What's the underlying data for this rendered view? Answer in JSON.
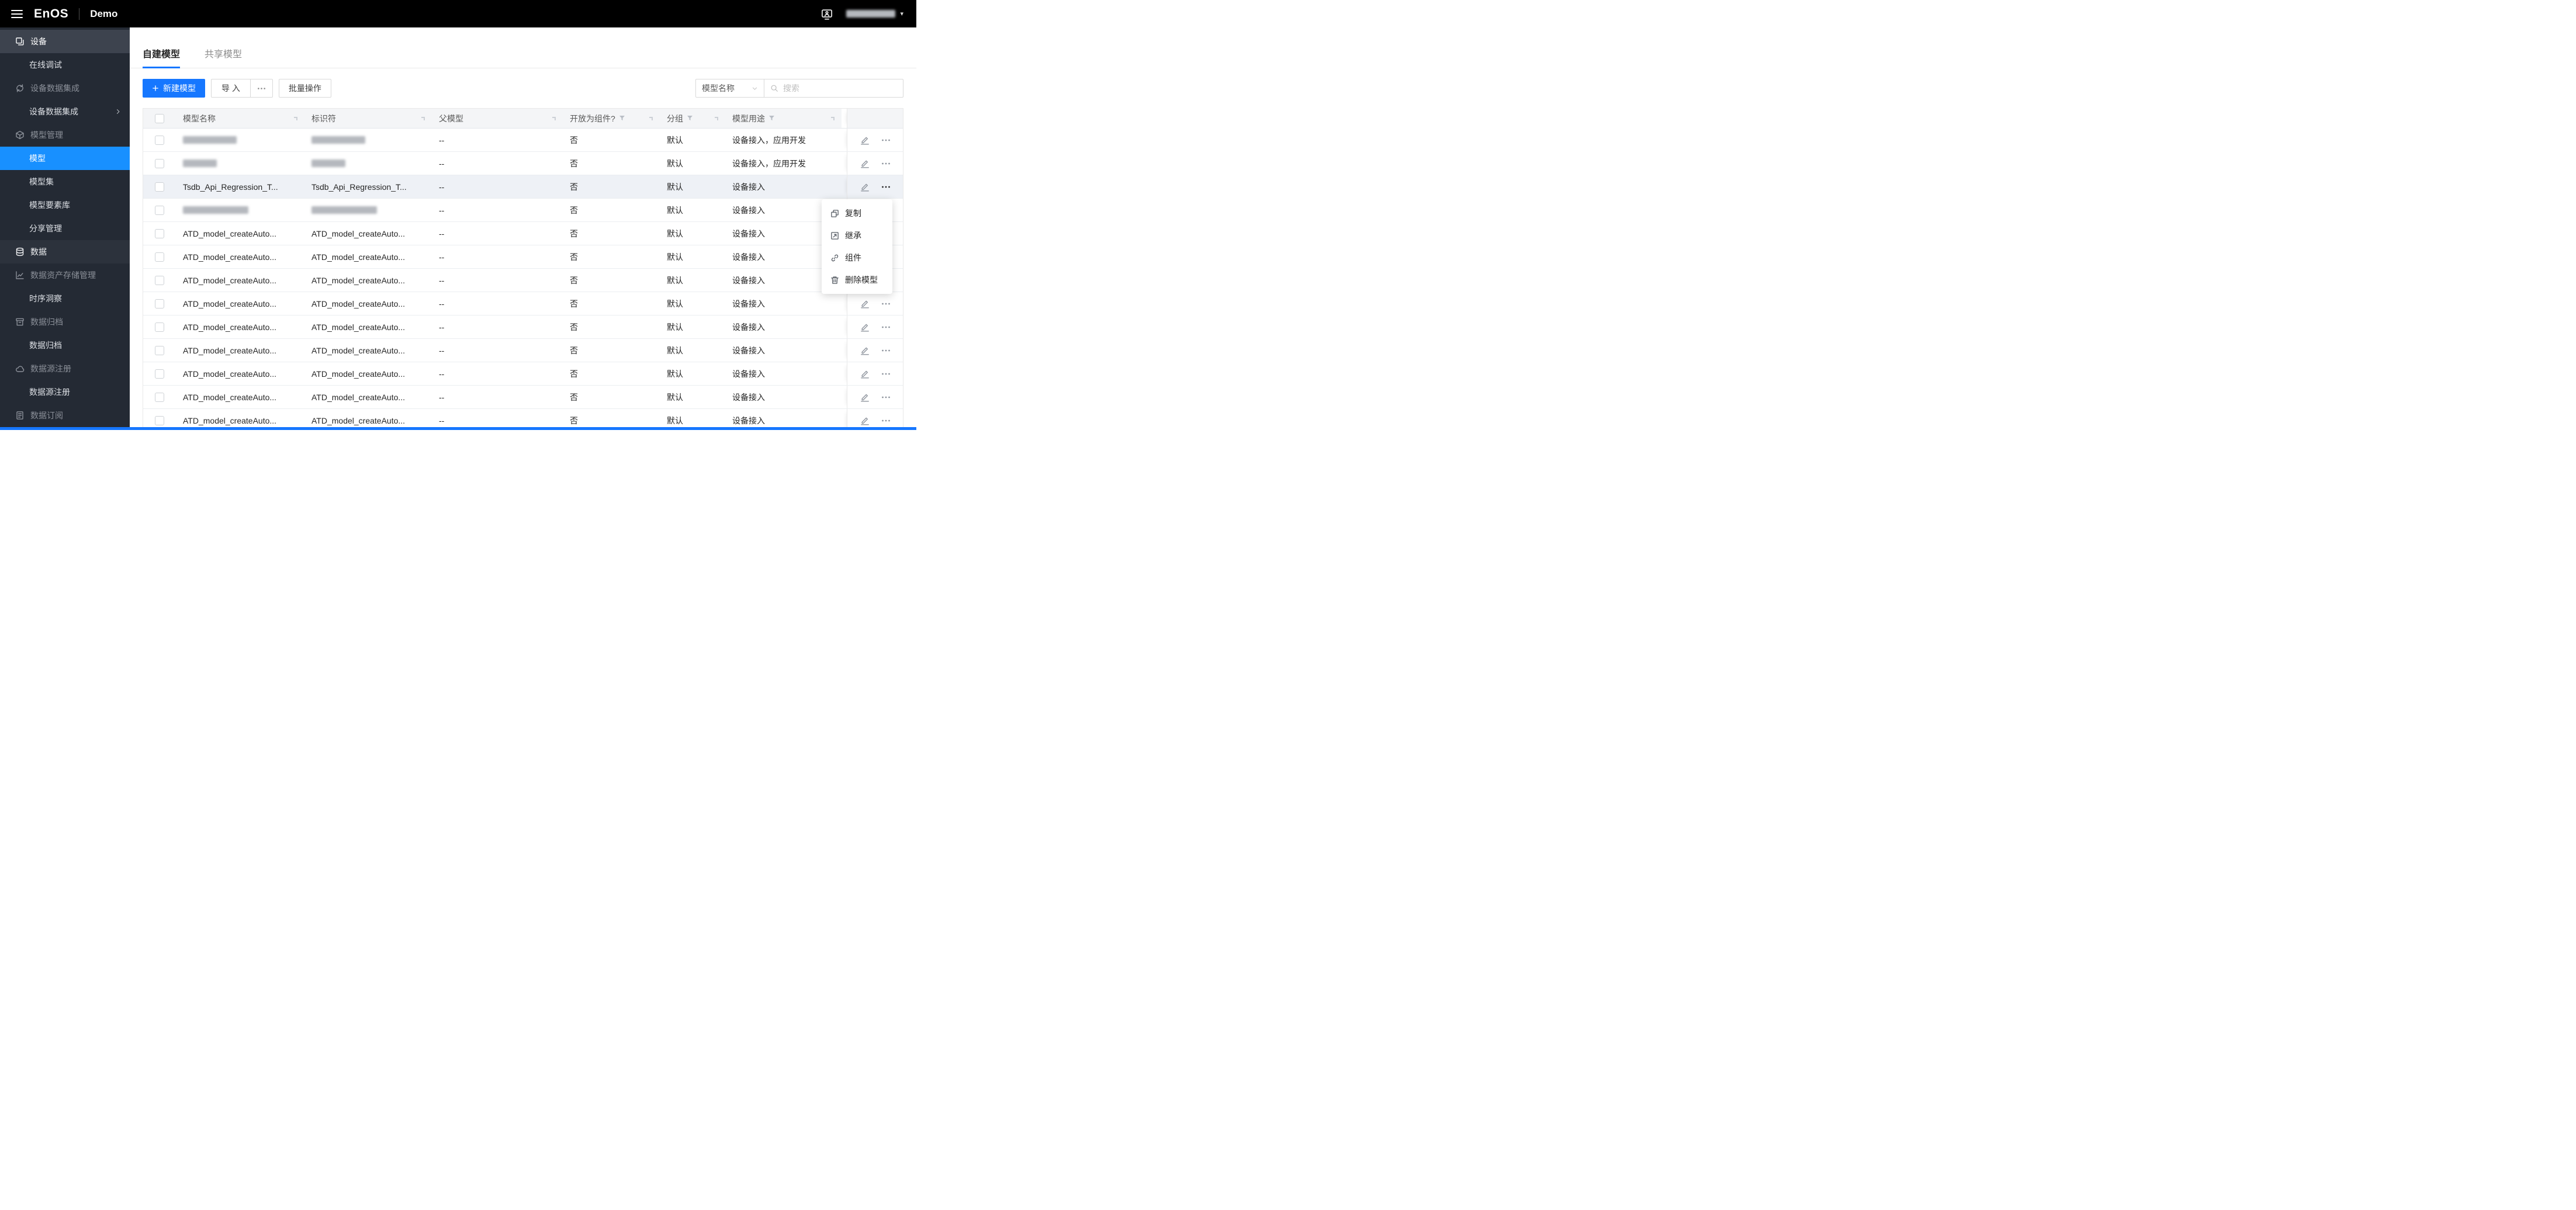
{
  "topbar": {
    "logo": "EnOS",
    "environment": "Demo",
    "user_redacted": true
  },
  "sidebar": {
    "items": [
      {
        "id": "device",
        "kind": "group-active",
        "icon": "device-icon",
        "label": "设备"
      },
      {
        "id": "online-debugging",
        "kind": "child",
        "label": "在线调试"
      },
      {
        "id": "device-data-integration-group",
        "kind": "group",
        "icon": "integration-icon",
        "label": "设备数据集成"
      },
      {
        "id": "device-data-integration",
        "kind": "child",
        "label": "设备数据集成",
        "chevron": true
      },
      {
        "id": "model-management-group",
        "kind": "group",
        "icon": "model-management-icon",
        "label": "模型管理"
      },
      {
        "id": "models",
        "kind": "child-active",
        "label": "模型"
      },
      {
        "id": "model-sets",
        "kind": "child",
        "label": "模型集"
      },
      {
        "id": "model-element-library",
        "kind": "child",
        "label": "模型要素库"
      },
      {
        "id": "share-management",
        "kind": "child",
        "label": "分享管理"
      },
      {
        "id": "data-group",
        "kind": "group-open",
        "icon": "database-icon",
        "label": "数据"
      },
      {
        "id": "data-asset-storage-group",
        "kind": "group",
        "icon": "data-storage-icon",
        "label": "数据资产存储管理"
      },
      {
        "id": "time-series-insight",
        "kind": "child",
        "label": "时序洞察"
      },
      {
        "id": "data-archive-group",
        "kind": "group",
        "icon": "archive-icon",
        "label": "数据归档"
      },
      {
        "id": "data-archive",
        "kind": "child",
        "label": "数据归档"
      },
      {
        "id": "data-source-registration-group",
        "kind": "group",
        "icon": "cloud-icon",
        "label": "数据源注册"
      },
      {
        "id": "data-source-registration",
        "kind": "child",
        "label": "数据源注册"
      },
      {
        "id": "data-subscription-group",
        "kind": "group",
        "icon": "subscription-icon",
        "label": "数据订阅"
      }
    ]
  },
  "tabs": [
    {
      "id": "self-built-models",
      "label": "自建模型",
      "active": true
    },
    {
      "id": "shared-models",
      "label": "共享模型",
      "active": false
    }
  ],
  "toolbar": {
    "new_model_label": "新建模型",
    "import_label": "导 入",
    "batch_label": "批量操作",
    "filter_field_value": "模型名称",
    "search_placeholder": "搜索"
  },
  "table": {
    "columns": [
      {
        "key": "name",
        "label": "模型名称",
        "filter": false
      },
      {
        "key": "id",
        "label": "标识符",
        "filter": false
      },
      {
        "key": "parent",
        "label": "父模型",
        "filter": false
      },
      {
        "key": "open",
        "label": "开放为组件?",
        "filter": true
      },
      {
        "key": "group",
        "label": "分组",
        "filter": true
      },
      {
        "key": "usage",
        "label": "模型用途",
        "filter": true
      }
    ],
    "rows": [
      {
        "redacted": true,
        "redact_size": "md",
        "parent": "--",
        "open": "否",
        "group": "默认",
        "usage": "设备接入，应用开发"
      },
      {
        "redacted": true,
        "redact_size": "sm",
        "parent": "--",
        "open": "否",
        "group": "默认",
        "usage": "设备接入，应用开发"
      },
      {
        "name": "Tsdb_Api_Regression_T...",
        "identifier": "Tsdb_Api_Regression_T...",
        "parent": "--",
        "open": "否",
        "group": "默认",
        "usage": "设备接入",
        "highlighted": true,
        "menu_open": true
      },
      {
        "redacted": true,
        "redact_size": "lg",
        "parent": "--",
        "open": "否",
        "group": "默认",
        "usage": "设备接入"
      },
      {
        "name": "ATD_model_createAuto...",
        "identifier": "ATD_model_createAuto...",
        "parent": "--",
        "open": "否",
        "group": "默认",
        "usage": "设备接入"
      },
      {
        "name": "ATD_model_createAuto...",
        "identifier": "ATD_model_createAuto...",
        "parent": "--",
        "open": "否",
        "group": "默认",
        "usage": "设备接入"
      },
      {
        "name": "ATD_model_createAuto...",
        "identifier": "ATD_model_createAuto...",
        "parent": "--",
        "open": "否",
        "group": "默认",
        "usage": "设备接入"
      },
      {
        "name": "ATD_model_createAuto...",
        "identifier": "ATD_model_createAuto...",
        "parent": "--",
        "open": "否",
        "group": "默认",
        "usage": "设备接入"
      },
      {
        "name": "ATD_model_createAuto...",
        "identifier": "ATD_model_createAuto...",
        "parent": "--",
        "open": "否",
        "group": "默认",
        "usage": "设备接入"
      },
      {
        "name": "ATD_model_createAuto...",
        "identifier": "ATD_model_createAuto...",
        "parent": "--",
        "open": "否",
        "group": "默认",
        "usage": "设备接入"
      },
      {
        "name": "ATD_model_createAuto...",
        "identifier": "ATD_model_createAuto...",
        "parent": "--",
        "open": "否",
        "group": "默认",
        "usage": "设备接入"
      },
      {
        "name": "ATD_model_createAuto...",
        "identifier": "ATD_model_createAuto...",
        "parent": "--",
        "open": "否",
        "group": "默认",
        "usage": "设备接入"
      },
      {
        "name": "ATD_model_createAuto...",
        "identifier": "ATD_model_createAuto...",
        "parent": "--",
        "open": "否",
        "group": "默认",
        "usage": "设备接入"
      }
    ]
  },
  "context_menu": {
    "items": [
      {
        "id": "copy",
        "icon": "copy-icon",
        "label": "复制"
      },
      {
        "id": "inherit",
        "icon": "inherit-icon",
        "label": "继承"
      },
      {
        "id": "component",
        "icon": "component-icon",
        "label": "组件"
      },
      {
        "id": "delete-model",
        "icon": "delete-icon",
        "label": "删除模型"
      }
    ]
  },
  "colors": {
    "accent": "#1677ff",
    "sidebar_active": "#1890ff",
    "topbar_bg": "#000000",
    "sidebar_bg": "#242a34"
  }
}
